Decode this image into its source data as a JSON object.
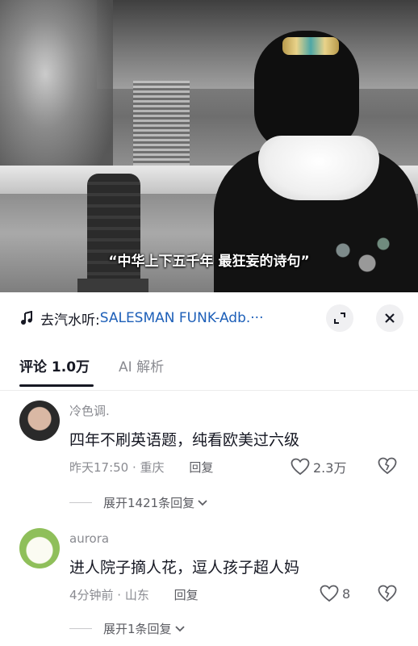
{
  "video": {
    "subtitle": "“中华上下五千年  最狂妄的诗句”"
  },
  "music": {
    "prefix": "去汽水听: ",
    "song": "SALESMAN FUNK-Adb.",
    "ellipsis": "···",
    "icon": "music-note-icon"
  },
  "tabs": [
    {
      "label": "评论 1.0万",
      "active": true
    },
    {
      "label": "AI 解析",
      "active": false
    }
  ],
  "comments": [
    {
      "username": "冷色调.",
      "text": "四年不刷英语题，纯看欧美过六级",
      "time_location": "昨天17:50 · 重庆",
      "reply_label": "回复",
      "likes": "2.3万",
      "expand_label": "展开1421条回复"
    },
    {
      "username": "aurora",
      "text": "进人院子摘人花，逗人孩子超人妈",
      "time_location": "4分钟前 · 山东",
      "reply_label": "回复",
      "likes": "8",
      "expand_label": "展开1条回复"
    }
  ],
  "colors": {
    "link": "#1d5fb8",
    "text_primary": "#161823",
    "text_secondary": "#8a8b91"
  }
}
